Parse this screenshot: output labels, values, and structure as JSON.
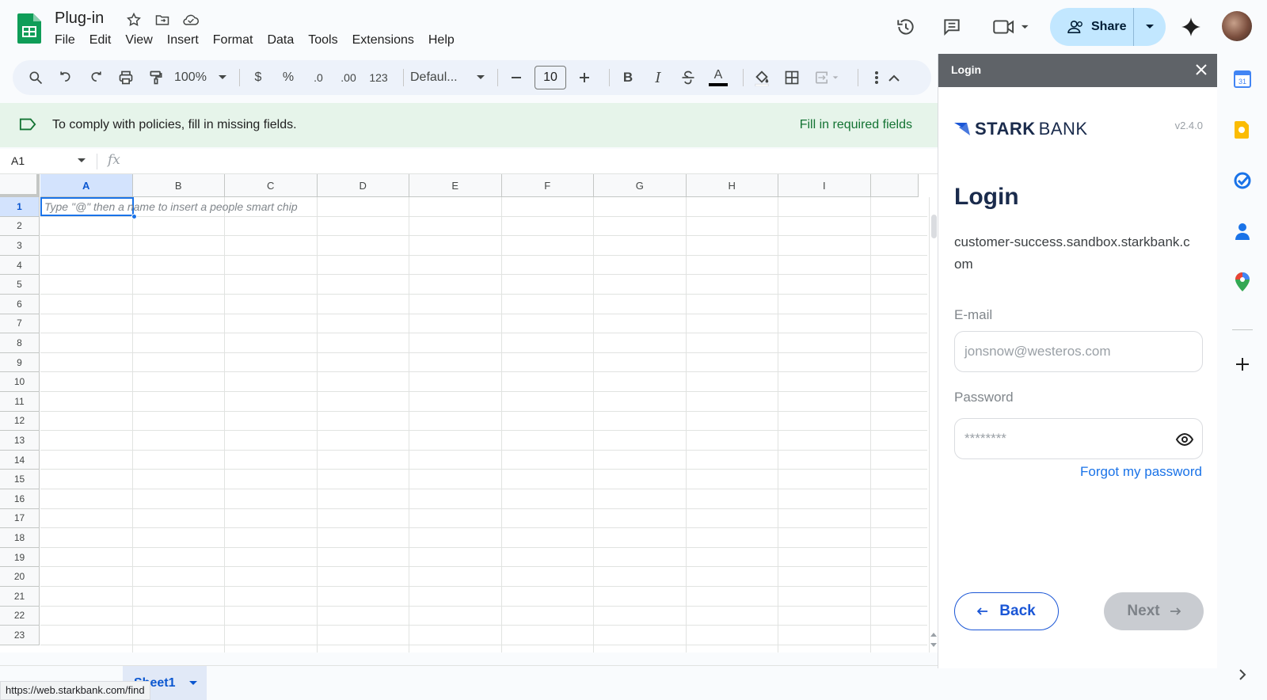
{
  "doc": {
    "title": "Plug-in",
    "menu": [
      "File",
      "Edit",
      "View",
      "Insert",
      "Format",
      "Data",
      "Tools",
      "Extensions",
      "Help"
    ]
  },
  "header": {
    "share_label": "Share"
  },
  "toolbar": {
    "zoom": "100%",
    "currency": "$",
    "percent": "%",
    "dec_decrease": ".0",
    "dec_increase": ".00",
    "number_format": "123",
    "font": "Defaul...",
    "font_size": "10",
    "bold": "B",
    "italic": "I",
    "text_color_glyph": "A"
  },
  "notice": {
    "message": "To comply with policies, fill in missing fields.",
    "action": "Fill in required fields",
    "accent": "#137333"
  },
  "formula_bar": {
    "cell_ref": "A1",
    "fx": "fx"
  },
  "grid": {
    "columns": [
      "A",
      "B",
      "C",
      "D",
      "E",
      "F",
      "G",
      "H",
      "I"
    ],
    "rows": [
      "1",
      "2",
      "3",
      "4",
      "5",
      "6",
      "7",
      "8",
      "9",
      "10",
      "11",
      "12",
      "13",
      "14",
      "15",
      "16",
      "17",
      "18",
      "19",
      "20",
      "21",
      "22",
      "23"
    ],
    "selected_cell": "A1",
    "hint": "Type \"@\" then a name to insert a people smart chip"
  },
  "sheets": {
    "active_tab": "Sheet1"
  },
  "status_url": "https://web.starkbank.com/find",
  "panel": {
    "header_title": "Login",
    "brand_bold": "STARK",
    "brand_light": "BANK",
    "version": "v2.4.0",
    "heading": "Login",
    "workspace": "customer-success.sandbox.starkbank.com",
    "email_label": "E-mail",
    "email_placeholder": "jonsnow@westeros.com",
    "password_label": "Password",
    "password_placeholder": "********",
    "forgot": "Forgot my password",
    "back": "Back",
    "next": "Next",
    "brand_color": "#1a56d6"
  },
  "icons": {
    "rail": [
      "calendar-icon",
      "keep-icon",
      "tasks-icon",
      "contacts-icon",
      "maps-icon",
      "add-icon"
    ]
  }
}
